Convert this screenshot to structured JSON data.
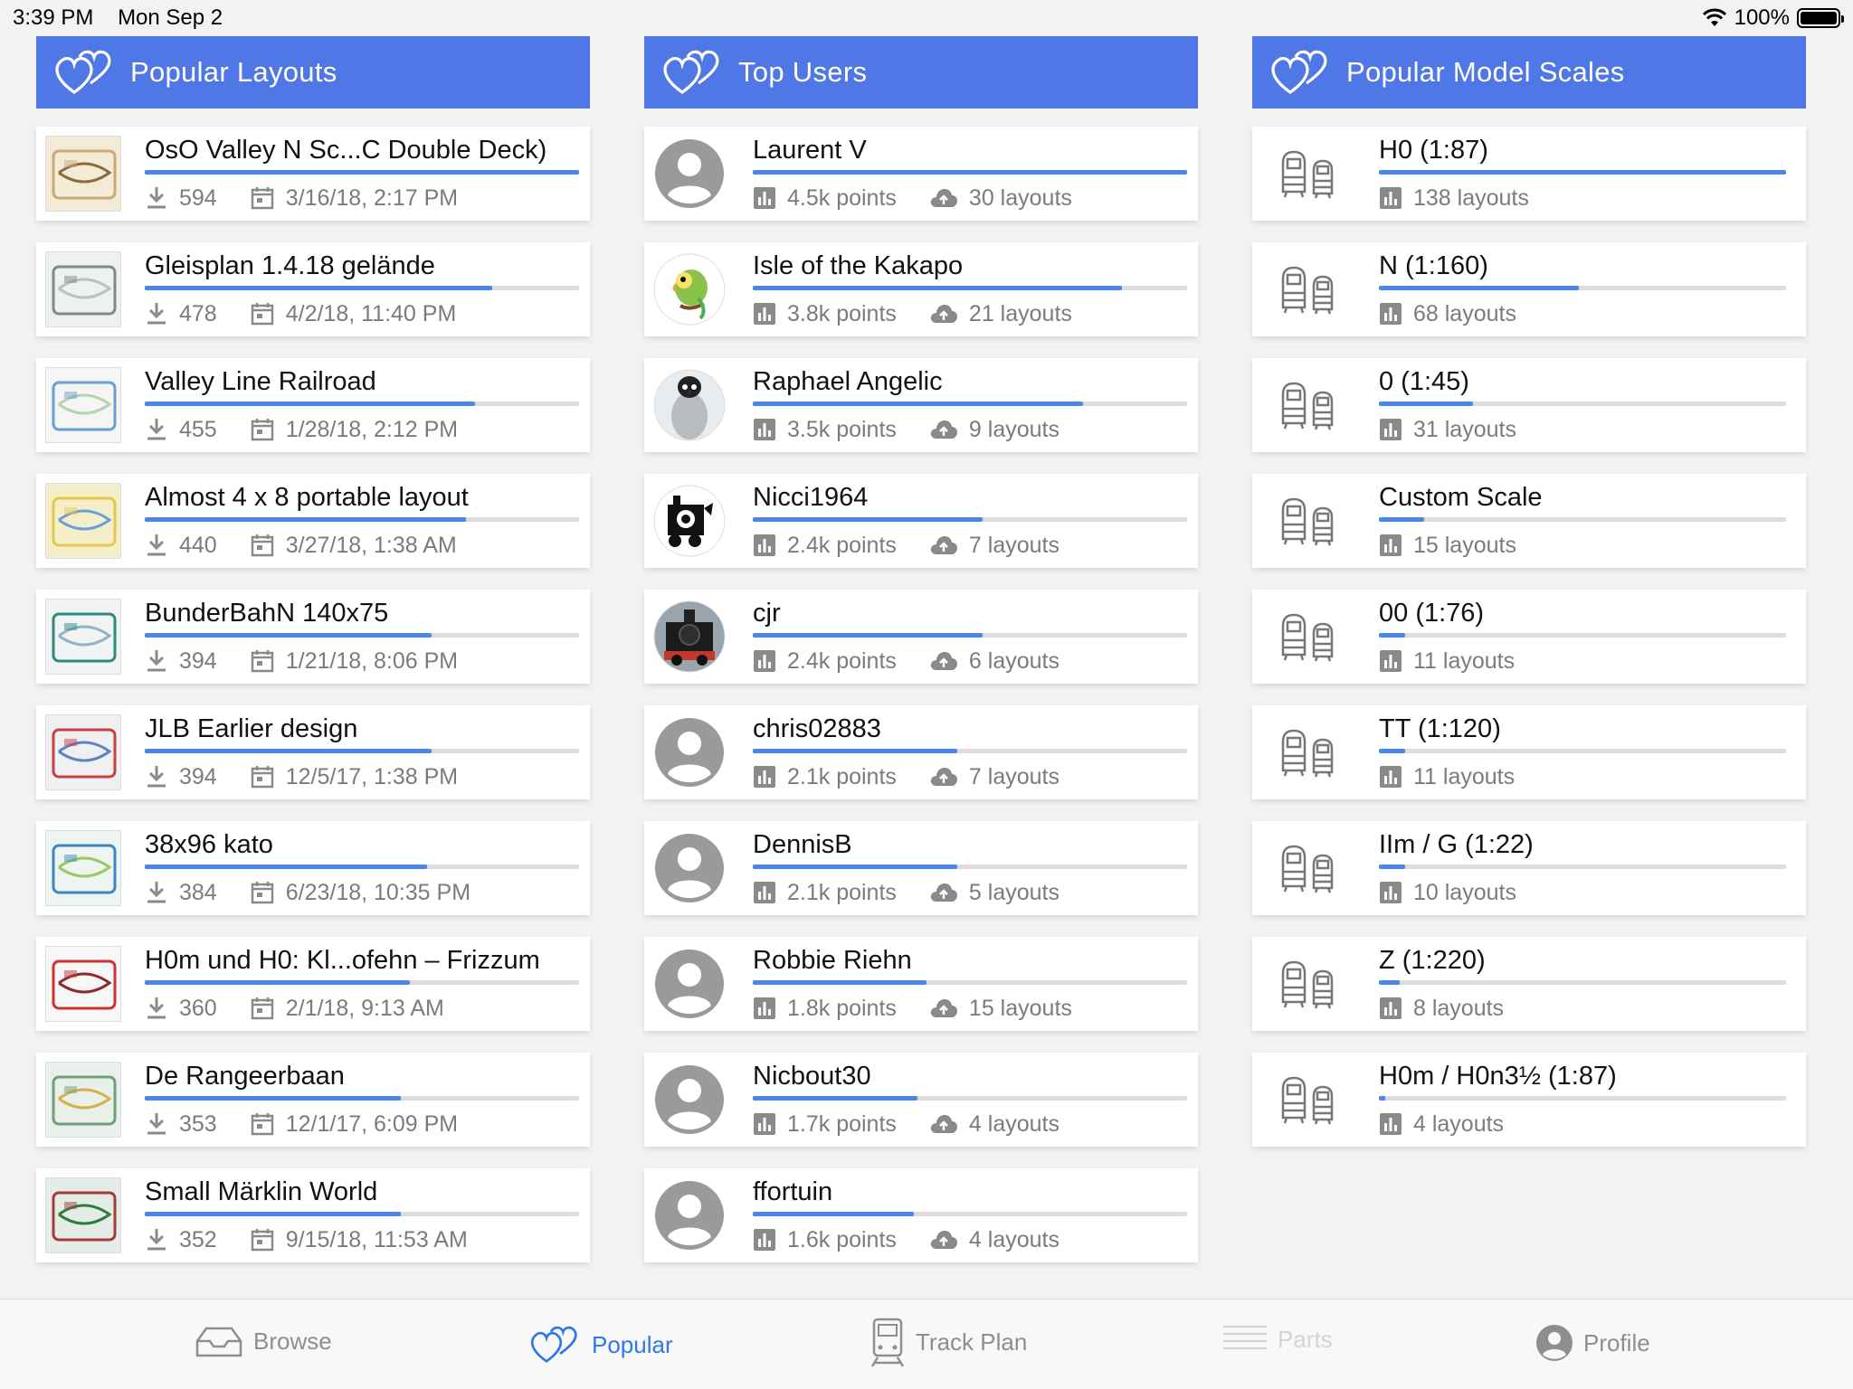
{
  "status_bar": {
    "time": "3:39 PM",
    "date": "Mon Sep 2",
    "battery": "100%"
  },
  "colors": {
    "header_blue": "#4f77e6",
    "progress_blue": "#4a86e8",
    "tab_active": "#2f78e8"
  },
  "columns": {
    "layouts": {
      "title": "Popular Layouts",
      "icon": "hearts-icon",
      "items": [
        {
          "title": "OsO Valley N Sc...C Double Deck)",
          "downloads": "594",
          "date": "3/16/18, 2:17 PM",
          "progress": 1.0
        },
        {
          "title": "Gleisplan 1.4.18 gelände",
          "downloads": "478",
          "date": "4/2/18, 11:40 PM",
          "progress": 0.8
        },
        {
          "title": "Valley Line Railroad",
          "downloads": "455",
          "date": "1/28/18, 2:12 PM",
          "progress": 0.76
        },
        {
          "title": "Almost 4 x 8 portable layout",
          "downloads": "440",
          "date": "3/27/18, 1:38 AM",
          "progress": 0.74
        },
        {
          "title": "BunderBahN 140x75",
          "downloads": "394",
          "date": "1/21/18, 8:06 PM",
          "progress": 0.66
        },
        {
          "title": "JLB Earlier design",
          "downloads": "394",
          "date": "12/5/17, 1:38 PM",
          "progress": 0.66
        },
        {
          "title": "38x96 kato",
          "downloads": "384",
          "date": "6/23/18, 10:35 PM",
          "progress": 0.65
        },
        {
          "title": "H0m und H0: Kl...ofehn – Frizzum",
          "downloads": "360",
          "date": "2/1/18, 9:13 AM",
          "progress": 0.61
        },
        {
          "title": "De Rangeerbaan",
          "downloads": "353",
          "date": "12/1/17, 6:09 PM",
          "progress": 0.59
        },
        {
          "title": "Small Märklin World",
          "downloads": "352",
          "date": "9/15/18, 11:53 AM",
          "progress": 0.59
        }
      ]
    },
    "users": {
      "title": "Top Users",
      "icon": "hearts-icon",
      "items": [
        {
          "name": "Laurent V",
          "points": "4.5k points",
          "layouts": "30 layouts",
          "progress": 1.0,
          "avatar": "default"
        },
        {
          "name": "Isle of the Kakapo",
          "points": "3.8k points",
          "layouts": "21 layouts",
          "progress": 0.85,
          "avatar": "parrot"
        },
        {
          "name": "Raphael Angelic",
          "points": "3.5k points",
          "layouts": "9 layouts",
          "progress": 0.76,
          "avatar": "penguin"
        },
        {
          "name": "Nicci1964",
          "points": "2.4k points",
          "layouts": "7 layouts",
          "progress": 0.53,
          "avatar": "locomotive-bw"
        },
        {
          "name": "cjr",
          "points": "2.4k points",
          "layouts": "6 layouts",
          "progress": 0.53,
          "avatar": "steam-loco"
        },
        {
          "name": "chris02883",
          "points": "2.1k points",
          "layouts": "7 layouts",
          "progress": 0.47,
          "avatar": "default"
        },
        {
          "name": "DennisB",
          "points": "2.1k points",
          "layouts": "5 layouts",
          "progress": 0.47,
          "avatar": "default"
        },
        {
          "name": "Robbie Riehn",
          "points": "1.8k points",
          "layouts": "15 layouts",
          "progress": 0.4,
          "avatar": "default"
        },
        {
          "name": "Nicbout30",
          "points": "1.7k points",
          "layouts": "4 layouts",
          "progress": 0.38,
          "avatar": "default"
        },
        {
          "name": "ffortuin",
          "points": "1.6k points",
          "layouts": "4 layouts",
          "progress": 0.37,
          "avatar": "default"
        }
      ]
    },
    "scales": {
      "title": "Popular Model Scales",
      "icon": "hearts-icon",
      "items": [
        {
          "name": "H0 (1:87)",
          "layouts": "138 layouts",
          "progress": 1.0
        },
        {
          "name": "N (1:160)",
          "layouts": "68 layouts",
          "progress": 0.49
        },
        {
          "name": "0 (1:45)",
          "layouts": "31 layouts",
          "progress": 0.23
        },
        {
          "name": "Custom Scale",
          "layouts": "15 layouts",
          "progress": 0.11
        },
        {
          "name": "00 (1:76)",
          "layouts": "11 layouts",
          "progress": 0.065
        },
        {
          "name": "TT (1:120)",
          "layouts": "11 layouts",
          "progress": 0.065
        },
        {
          "name": "IIm / G (1:22)",
          "layouts": "10 layouts",
          "progress": 0.065
        },
        {
          "name": "Z (1:220)",
          "layouts": "8 layouts",
          "progress": 0.05
        },
        {
          "name": "H0m / H0n3½ (1:87)",
          "layouts": "4 layouts",
          "progress": 0.015
        }
      ]
    }
  },
  "tabs": [
    {
      "label": "Browse",
      "icon": "tray-icon",
      "state": "normal"
    },
    {
      "label": "Popular",
      "icon": "hearts-icon",
      "state": "active"
    },
    {
      "label": "Track Plan",
      "icon": "train-icon",
      "state": "normal"
    },
    {
      "label": "Parts",
      "icon": "list-icon",
      "state": "disabled"
    },
    {
      "label": "Profile",
      "icon": "person-icon",
      "state": "normal"
    }
  ]
}
